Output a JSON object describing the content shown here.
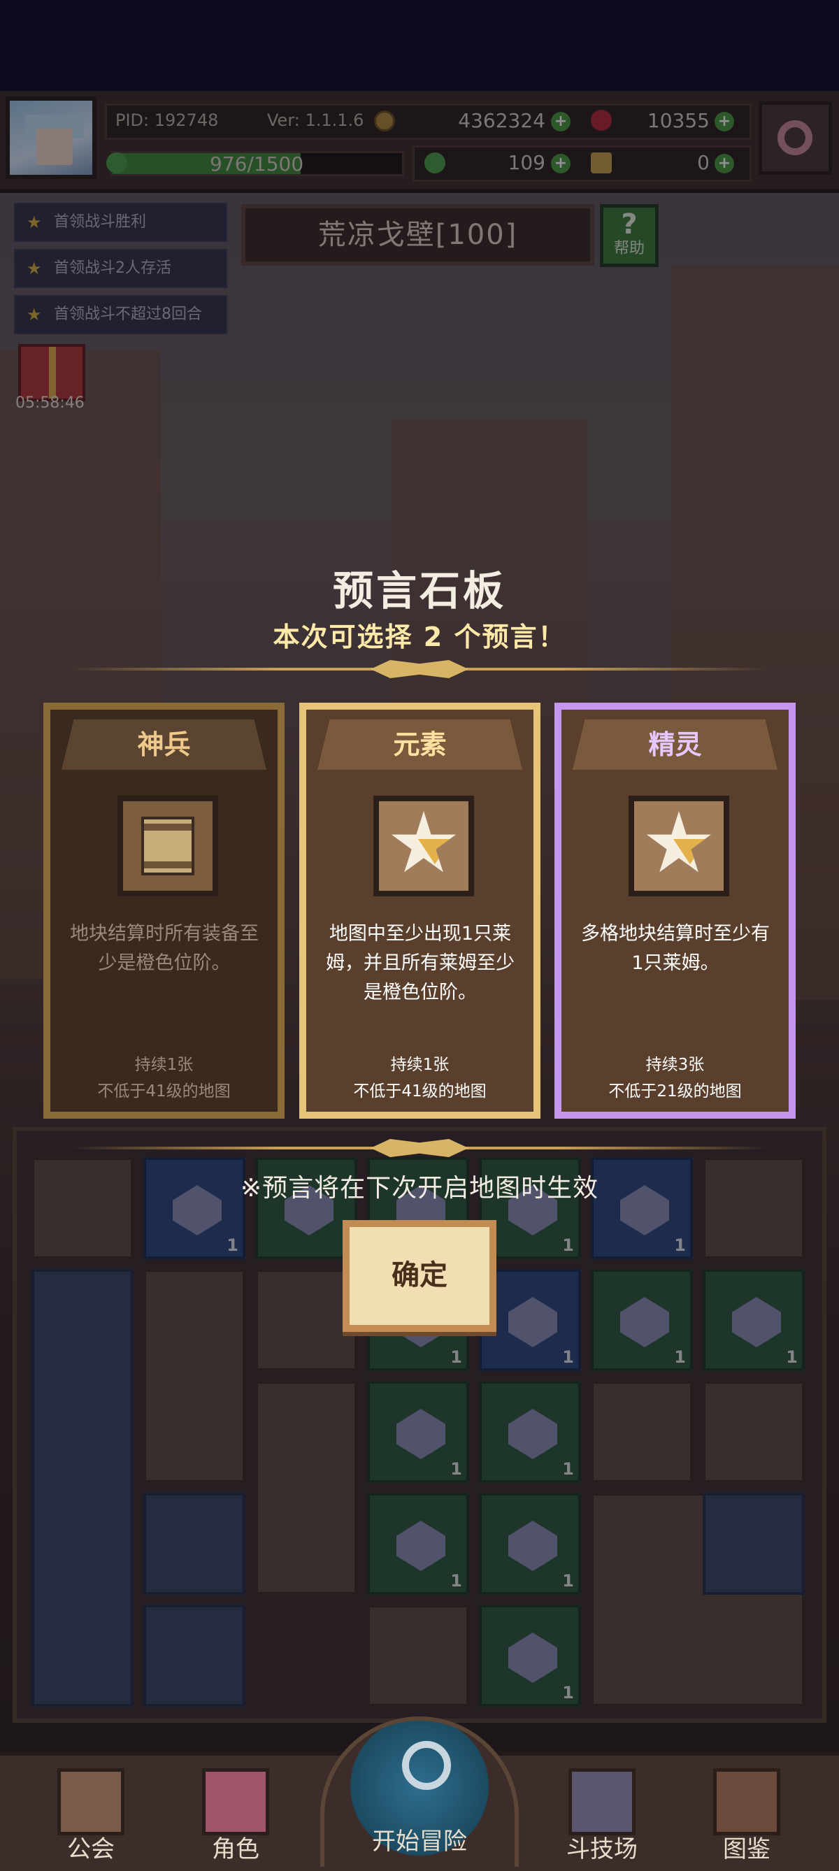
{
  "header": {
    "pid_label": "PID: 192748",
    "version_label": "Ver: 1.1.1.6",
    "gold": "4362324",
    "gems": "10355",
    "xp": "976/1500",
    "xp_fraction": 0.65,
    "clover": "109",
    "keys": "0"
  },
  "quests": [
    "首领战斗胜利",
    "首领战斗2人存活",
    "首领战斗不超过8回合"
  ],
  "map": {
    "title": "荒凉戈壁[100]",
    "help_label": "帮助"
  },
  "gift": {
    "timer": "05:58:46"
  },
  "modal": {
    "title": "预言石板",
    "subtitle": "本次可选择 2 个预言！",
    "cards": [
      {
        "name": "神兵",
        "desc": "地块结算时所有装备至少是橙色位阶。",
        "duration": "持续1张",
        "requirement": "不低于41级的地图",
        "icon": "scroll-icon",
        "state": "dimmed"
      },
      {
        "name": "元素",
        "desc": "地图中至少出现1只莱姆，并且所有莱姆至少是橙色位阶。",
        "duration": "持续1张",
        "requirement": "不低于41级的地图",
        "icon": "star-emblem-icon",
        "state": "gold"
      },
      {
        "name": "精灵",
        "desc": "多格地块结算时至少有1只莱姆。",
        "duration": "持续3张",
        "requirement": "不低于21级的地图",
        "icon": "star-emblem-icon",
        "state": "purple"
      }
    ],
    "notice": "※预言将在下次开启地图时生效",
    "confirm_label": "确定"
  },
  "board": {
    "tile_count": "1"
  },
  "nav": {
    "guild": "公会",
    "character": "角色",
    "start": "开始冒险",
    "arena": "斗技场",
    "codex": "图鉴"
  },
  "colors": {
    "gold_border": "#e8c47a",
    "purple_border": "#c596ee",
    "accent_text": "#ffe9a8"
  }
}
